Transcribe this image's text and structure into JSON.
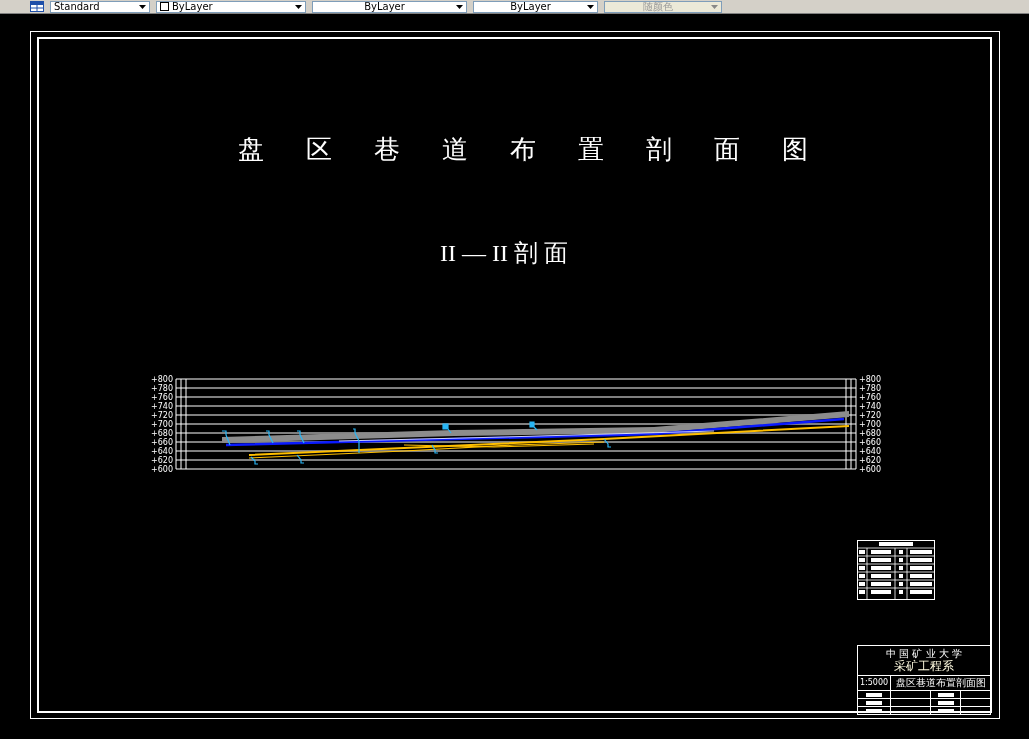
{
  "toolbar": {
    "dropdowns": [
      {
        "kind": "style",
        "value": "Standard",
        "disabled": false
      },
      {
        "kind": "layer",
        "value": "ByLayer",
        "disabled": false
      },
      {
        "kind": "plain",
        "value": "ByLayer",
        "disabled": false
      },
      {
        "kind": "plain",
        "value": "ByLayer",
        "disabled": false
      },
      {
        "kind": "plain",
        "value": "随颜色",
        "disabled": true
      }
    ]
  },
  "drawing": {
    "title": "盘区巷道布置剖面图",
    "subtitle": "II — II 剖 面",
    "section": {
      "left_elevations": [
        "+800",
        "+780",
        "+760",
        "+740",
        "+720",
        "+700",
        "+680",
        "+660",
        "+640",
        "+620",
        "+600"
      ],
      "right_elevations": [
        "+800",
        "+780",
        "+760",
        "+740",
        "+720",
        "+700",
        "+680",
        "+660",
        "+640",
        "+620",
        "+600"
      ]
    },
    "title_block": {
      "university": "中 国 矿 业 大 学",
      "department": "采矿工程系",
      "scale": "1:5000",
      "drawing_name": "盘区巷道布置剖面图"
    }
  }
}
